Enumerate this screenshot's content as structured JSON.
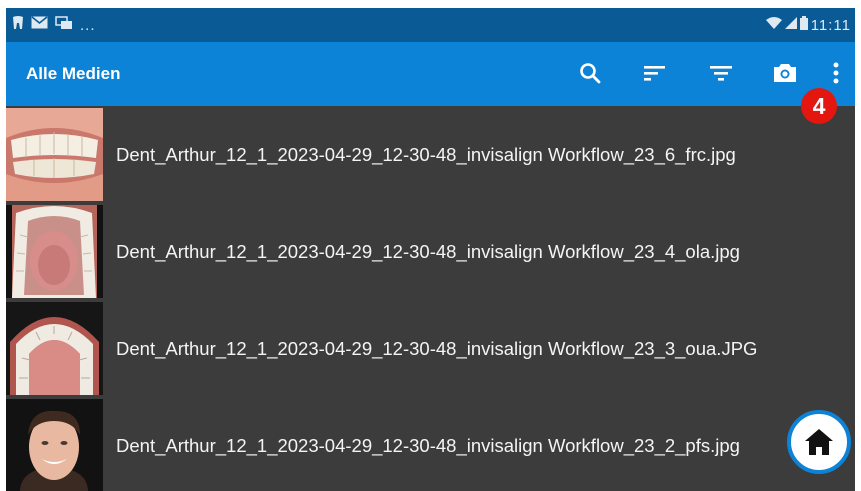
{
  "status_bar": {
    "notification_icons": [
      "tooth-icon",
      "mail-icon",
      "chat-icon"
    ],
    "overflow": "...",
    "time": "11:11",
    "signal_icons": [
      "wifi-icon",
      "signal-icon",
      "battery-icon"
    ]
  },
  "app_bar": {
    "title": "Alle Medien",
    "actions": [
      "search-icon",
      "sort-icon",
      "filter-icon",
      "camera-icon",
      "more-vert-icon"
    ],
    "badge": "4"
  },
  "files": [
    {
      "name": "Dent_Arthur_12_1_2023-04-29_12-30-48_invisalign Workflow_23_6_frc.jpg",
      "thumb": "frontal-teeth"
    },
    {
      "name": "Dent_Arthur_12_1_2023-04-29_12-30-48_invisalign Workflow_23_4_ola.jpg",
      "thumb": "lower-occlusal"
    },
    {
      "name": "Dent_Arthur_12_1_2023-04-29_12-30-48_invisalign Workflow_23_3_oua.JPG",
      "thumb": "upper-occlusal"
    },
    {
      "name": "Dent_Arthur_12_1_2023-04-29_12-30-48_invisalign Workflow_23_2_pfs.jpg",
      "thumb": "portrait-smile"
    }
  ],
  "fab": {
    "icon": "home-icon"
  },
  "colors": {
    "status_bar": "#0a5a96",
    "app_bar": "#0c83d6",
    "list_bg": "#3c3c3c",
    "badge": "#e3170f"
  }
}
